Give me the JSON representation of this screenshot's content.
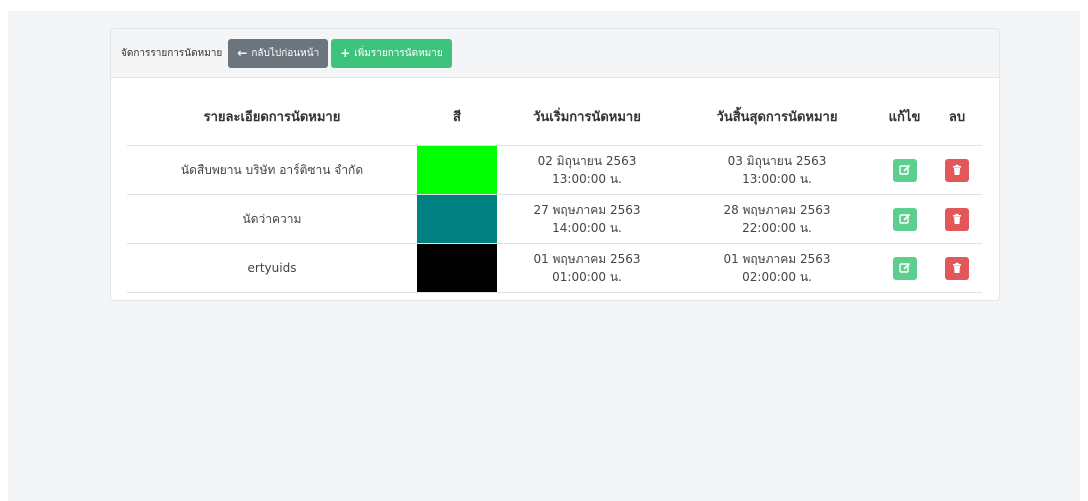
{
  "header": {
    "title": "จัดการรายการนัดหมาย",
    "back_label": "กลับไปก่อนหน้า",
    "add_label": "เพิ่มรายการนัดหมาย"
  },
  "table": {
    "columns": [
      "รายละเอียดการนัดหมาย",
      "สี",
      "วันเริ่มการนัดหมาย",
      "วันสิ้นสุดการนัดหมาย",
      "แก้ไข",
      "ลบ"
    ],
    "rows": [
      {
        "detail": "นัดสืบพยาน บริษัท อาร์ติซาน จำกัด",
        "color": "#00ff00",
        "start_date": "02 มิถุนายน 2563",
        "start_time": "13:00:00 น.",
        "end_date": "03 มิถุนายน 2563",
        "end_time": "13:00:00 น."
      },
      {
        "detail": "นัดว่าความ",
        "color": "#008080",
        "start_date": "27 พฤษภาคม 2563",
        "start_time": "14:00:00 น.",
        "end_date": "28 พฤษภาคม 2563",
        "end_time": "22:00:00 น."
      },
      {
        "detail": "ertyuids",
        "color": "#000000",
        "start_date": "01 พฤษภาคม 2563",
        "start_time": "01:00:00 น.",
        "end_date": "01 พฤษภาคม 2563",
        "end_time": "02:00:00 น."
      }
    ]
  },
  "icons": {
    "back": "arrow-left-icon",
    "add": "plus-icon",
    "edit": "edit-icon",
    "delete": "trash-icon"
  },
  "colors": {
    "back_button": "#6c757d",
    "add_button": "#3ec37d",
    "edit_button": "#5ccf8f",
    "delete_button": "#e2585a"
  }
}
